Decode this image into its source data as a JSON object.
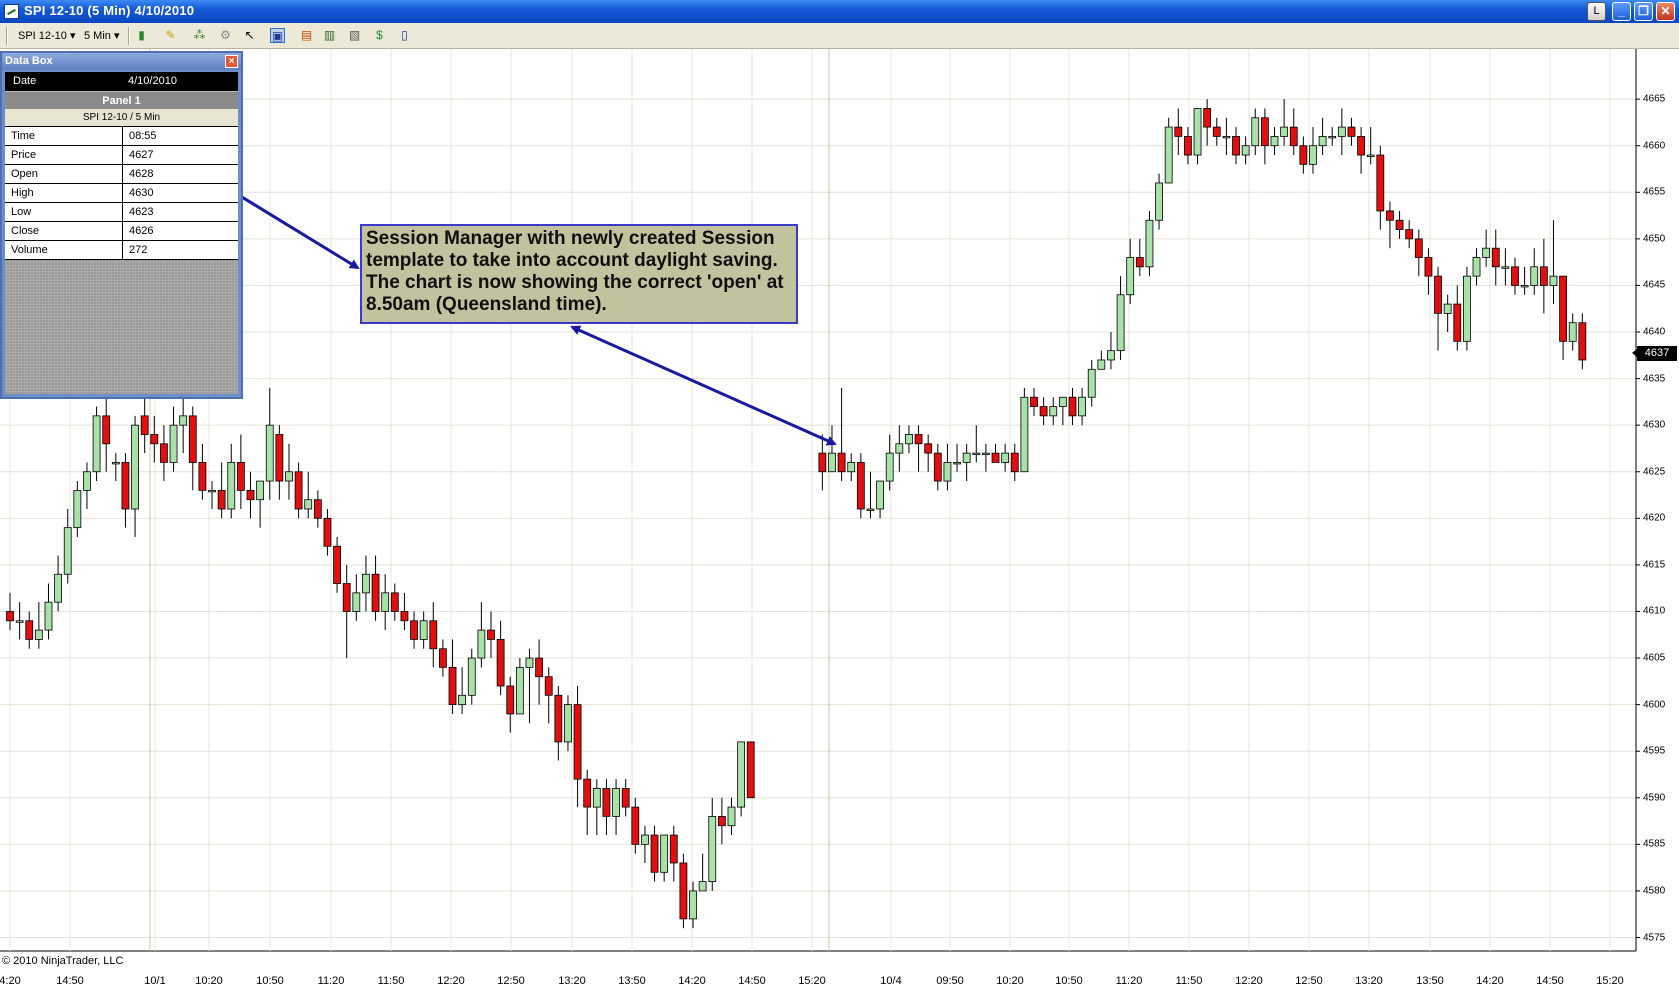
{
  "window": {
    "title": "SPI 12-10 (5 Min)  4/10/2010",
    "buttons": [
      "L",
      "_",
      "❐",
      "✕"
    ]
  },
  "toolbar": {
    "instrument": "SPI 12-10",
    "interval": "5 Min"
  },
  "databox": {
    "title": "Data Box",
    "date_label": "Date",
    "date_value": "4/10/2010",
    "panel": "Panel 1",
    "series": "SPI 12-10 / 5 Min",
    "rows": [
      {
        "label": "Time",
        "value": "08:55"
      },
      {
        "label": "Price",
        "value": "4627"
      },
      {
        "label": "Open",
        "value": "4628"
      },
      {
        "label": "High",
        "value": "4630"
      },
      {
        "label": "Low",
        "value": "4623"
      },
      {
        "label": "Close",
        "value": "4626"
      },
      {
        "label": "Volume",
        "value": "272"
      }
    ]
  },
  "callout": {
    "text": "Session Manager with newly created Session template to take into account daylight saving. The chart is now showing the correct 'open' at 8.50am (Queensland time)."
  },
  "copyright": "© 2010 NinjaTrader, LLC",
  "colors": {
    "up": "#a8e2a8",
    "down": "#e01010",
    "wick": "#000000",
    "grid": "#e4e4d8",
    "arrow": "#1a1aa0"
  },
  "axis": {
    "last_price": "4637",
    "x_labels": [
      "4:20",
      "14:50",
      "10/1",
      "10:20",
      "10:50",
      "11:20",
      "11:50",
      "12:20",
      "12:50",
      "13:20",
      "13:50",
      "14:20",
      "14:50",
      "15:20",
      "10/4",
      "09:50",
      "10:20",
      "10:50",
      "11:20",
      "11:50",
      "12:20",
      "12:50",
      "13:20",
      "13:50",
      "14:20",
      "14:50",
      "15:20"
    ]
  },
  "chart_data": {
    "type": "candlestick",
    "y_ticks": [
      4575,
      4580,
      4585,
      4590,
      4595,
      4600,
      4605,
      4610,
      4615,
      4620,
      4625,
      4630,
      4635,
      4640,
      4645,
      4650,
      4655,
      4660,
      4665
    ],
    "ylim": [
      4572,
      4669
    ],
    "session_breaks": [
      "10/1",
      "10/4"
    ],
    "candles": [
      [
        4610,
        4612,
        4608,
        4609
      ],
      [
        4609,
        4611,
        4607,
        4609
      ],
      [
        4609,
        4610,
        4606,
        4607
      ],
      [
        4607,
        4611,
        4606,
        4608
      ],
      [
        4608,
        4613,
        4607,
        4611
      ],
      [
        4611,
        4616,
        4610,
        4614
      ],
      [
        4614,
        4621,
        4613,
        4619
      ],
      [
        4619,
        4624,
        4618,
        4623
      ],
      [
        4623,
        4626,
        4621,
        4625
      ],
      [
        4625,
        4632,
        4624,
        4631
      ],
      [
        4631,
        4634,
        4625,
        4628
      ],
      [
        4626,
        4627,
        4624,
        4626
      ],
      [
        4626,
        4627,
        4619,
        4621
      ],
      [
        4621,
        4631,
        4618,
        4630
      ],
      [
        4631,
        4633,
        4627,
        4629
      ],
      [
        4629,
        4631,
        4626,
        4628
      ],
      [
        4628,
        4630,
        4624,
        4626
      ],
      [
        4626,
        4632,
        4625,
        4630
      ],
      [
        4630,
        4634,
        4627,
        4631
      ],
      [
        4631,
        4632,
        4623,
        4626
      ],
      [
        4626,
        4628,
        4622,
        4623
      ],
      [
        4623,
        4624,
        4621,
        4623
      ],
      [
        4623,
        4626,
        4620,
        4621
      ],
      [
        4621,
        4628,
        4620,
        4626
      ],
      [
        4626,
        4629,
        4621,
        4623
      ],
      [
        4623,
        4625,
        4620,
        4622
      ],
      [
        4622,
        4624,
        4619,
        4624
      ],
      [
        4624,
        4634,
        4622,
        4630
      ],
      [
        4629,
        4630,
        4622,
        4624
      ],
      [
        4624,
        4628,
        4622,
        4625
      ],
      [
        4625,
        4626,
        4620,
        4621
      ],
      [
        4621,
        4625,
        4620,
        4622
      ],
      [
        4622,
        4623,
        4619,
        4620
      ],
      [
        4620,
        4621,
        4616,
        4617
      ],
      [
        4617,
        4618,
        4612,
        4613
      ],
      [
        4613,
        4615,
        4605,
        4610
      ],
      [
        4610,
        4614,
        4609,
        4612
      ],
      [
        4612,
        4616,
        4610,
        4614
      ],
      [
        4614,
        4616,
        4609,
        4610
      ],
      [
        4610,
        4614,
        4608,
        4612
      ],
      [
        4612,
        4613,
        4609,
        4610
      ],
      [
        4610,
        4612,
        4608,
        4609
      ],
      [
        4609,
        4610,
        4606,
        4607
      ],
      [
        4607,
        4610,
        4606,
        4609
      ],
      [
        4609,
        4611,
        4604,
        4606
      ],
      [
        4606,
        4607,
        4603,
        4604
      ],
      [
        4604,
        4607,
        4599,
        4600
      ],
      [
        4600,
        4604,
        4599,
        4601
      ],
      [
        4601,
        4606,
        4600,
        4605
      ],
      [
        4605,
        4611,
        4604,
        4608
      ],
      [
        4608,
        4610,
        4605,
        4607
      ],
      [
        4607,
        4609,
        4601,
        4602
      ],
      [
        4602,
        4603,
        4597,
        4599
      ],
      [
        4599,
        4605,
        4599,
        4604
      ],
      [
        4604,
        4606,
        4598,
        4605
      ],
      [
        4605,
        4607,
        4600,
        4603
      ],
      [
        4603,
        4604,
        4598,
        4601
      ],
      [
        4601,
        4602,
        4594,
        4596
      ],
      [
        4596,
        4601,
        4595,
        4600
      ],
      [
        4600,
        4602,
        4589,
        4592
      ],
      [
        4592,
        4593,
        4586,
        4589
      ],
      [
        4589,
        4592,
        4586,
        4591
      ],
      [
        4591,
        4592,
        4586,
        4588
      ],
      [
        4588,
        4592,
        4586,
        4591
      ],
      [
        4591,
        4592,
        4588,
        4589
      ],
      [
        4589,
        4590,
        4584,
        4585
      ],
      [
        4585,
        4587,
        4583,
        4586
      ],
      [
        4586,
        4587,
        4581,
        4582
      ],
      [
        4582,
        4586,
        4581,
        4586
      ],
      [
        4586,
        4587,
        4581,
        4583
      ],
      [
        4583,
        4584,
        4576,
        4577
      ],
      [
        4577,
        4581,
        4576,
        4580
      ],
      [
        4580,
        4584,
        4580,
        4581
      ],
      [
        4581,
        4590,
        4580,
        4588
      ],
      [
        4588,
        4590,
        4585,
        4587
      ],
      [
        4587,
        4590,
        4586,
        4589
      ],
      [
        4589,
        4596,
        4588,
        4596
      ],
      [
        4596,
        4596,
        4590,
        4590
      ],
      [
        4627,
        4629,
        4623,
        4625
      ],
      [
        4625,
        4630,
        4625,
        4627
      ],
      [
        4627,
        4634,
        4624,
        4625
      ],
      [
        4625,
        4627,
        4624,
        4626
      ],
      [
        4626,
        4627,
        4620,
        4621
      ],
      [
        4621,
        4625,
        4620,
        4621
      ],
      [
        4621,
        4624,
        4620,
        4624
      ],
      [
        4624,
        4629,
        4623,
        4627
      ],
      [
        4627,
        4630,
        4625,
        4628
      ],
      [
        4628,
        4630,
        4627,
        4629
      ],
      [
        4629,
        4630,
        4625,
        4628
      ],
      [
        4628,
        4629,
        4625,
        4627
      ],
      [
        4627,
        4628,
        4623,
        4624
      ],
      [
        4624,
        4628,
        4623,
        4626
      ],
      [
        4626,
        4628,
        4625,
        4626
      ],
      [
        4626,
        4628,
        4624,
        4627
      ],
      [
        4627,
        4630,
        4626,
        4627
      ],
      [
        4627,
        4628,
        4625,
        4627
      ],
      [
        4627,
        4628,
        4626,
        4626
      ],
      [
        4626,
        4628,
        4625,
        4627
      ],
      [
        4627,
        4628,
        4624,
        4625
      ],
      [
        4625,
        4634,
        4625,
        4633
      ],
      [
        4633,
        4634,
        4631,
        4632
      ],
      [
        4632,
        4633,
        4630,
        4631
      ],
      [
        4631,
        4633,
        4630,
        4632
      ],
      [
        4632,
        4633,
        4630,
        4633
      ],
      [
        4633,
        4634,
        4630,
        4631
      ],
      [
        4631,
        4634,
        4630,
        4633
      ],
      [
        4633,
        4637,
        4632,
        4636
      ],
      [
        4636,
        4638,
        4636,
        4637
      ],
      [
        4637,
        4640,
        4636,
        4638
      ],
      [
        4638,
        4646,
        4637,
        4644
      ],
      [
        4644,
        4650,
        4643,
        4648
      ],
      [
        4648,
        4650,
        4646,
        4647
      ],
      [
        4647,
        4653,
        4646,
        4652
      ],
      [
        4652,
        4657,
        4651,
        4656
      ],
      [
        4656,
        4663,
        4656,
        4662
      ],
      [
        4662,
        4664,
        4659,
        4661
      ],
      [
        4661,
        4662,
        4658,
        4659
      ],
      [
        4659,
        4664,
        4658,
        4664
      ],
      [
        4664,
        4665,
        4660,
        4662
      ],
      [
        4662,
        4663,
        4660,
        4661
      ],
      [
        4661,
        4663,
        4659,
        4661
      ],
      [
        4661,
        4662,
        4658,
        4659
      ],
      [
        4659,
        4661,
        4658,
        4660
      ],
      [
        4660,
        4664,
        4659,
        4663
      ],
      [
        4663,
        4664,
        4658,
        4660
      ],
      [
        4660,
        4662,
        4659,
        4661
      ],
      [
        4661,
        4665,
        4660,
        4662
      ],
      [
        4662,
        4664,
        4659,
        4660
      ],
      [
        4660,
        4661,
        4657,
        4658
      ],
      [
        4658,
        4662,
        4657,
        4660
      ],
      [
        4660,
        4663,
        4659,
        4661
      ],
      [
        4661,
        4662,
        4660,
        4661
      ],
      [
        4661,
        4664,
        4659,
        4662
      ],
      [
        4662,
        4663,
        4660,
        4661
      ],
      [
        4661,
        4662,
        4657,
        4659
      ],
      [
        4659,
        4662,
        4658,
        4659
      ],
      [
        4659,
        4660,
        4651,
        4653
      ],
      [
        4653,
        4654,
        4649,
        4652
      ],
      [
        4652,
        4653,
        4650,
        4651
      ],
      [
        4651,
        4652,
        4649,
        4650
      ],
      [
        4650,
        4651,
        4646,
        4648
      ],
      [
        4648,
        4649,
        4644,
        4646
      ],
      [
        4646,
        4647,
        4638,
        4642
      ],
      [
        4642,
        4644,
        4640,
        4643
      ],
      [
        4643,
        4645,
        4638,
        4639
      ],
      [
        4639,
        4647,
        4638,
        4646
      ],
      [
        4646,
        4649,
        4645,
        4648
      ],
      [
        4648,
        4651,
        4647,
        4649
      ],
      [
        4649,
        4651,
        4645,
        4647
      ],
      [
        4647,
        4649,
        4645,
        4647
      ],
      [
        4647,
        4648,
        4644,
        4645
      ],
      [
        4645,
        4647,
        4644,
        4645
      ],
      [
        4645,
        4649,
        4644,
        4647
      ],
      [
        4647,
        4650,
        4642,
        4645
      ],
      [
        4645,
        4652,
        4643,
        4646
      ],
      [
        4646,
        4646,
        4637,
        4639
      ],
      [
        4639,
        4642,
        4638,
        4641
      ],
      [
        4641,
        4642,
        4636,
        4637
      ]
    ]
  }
}
